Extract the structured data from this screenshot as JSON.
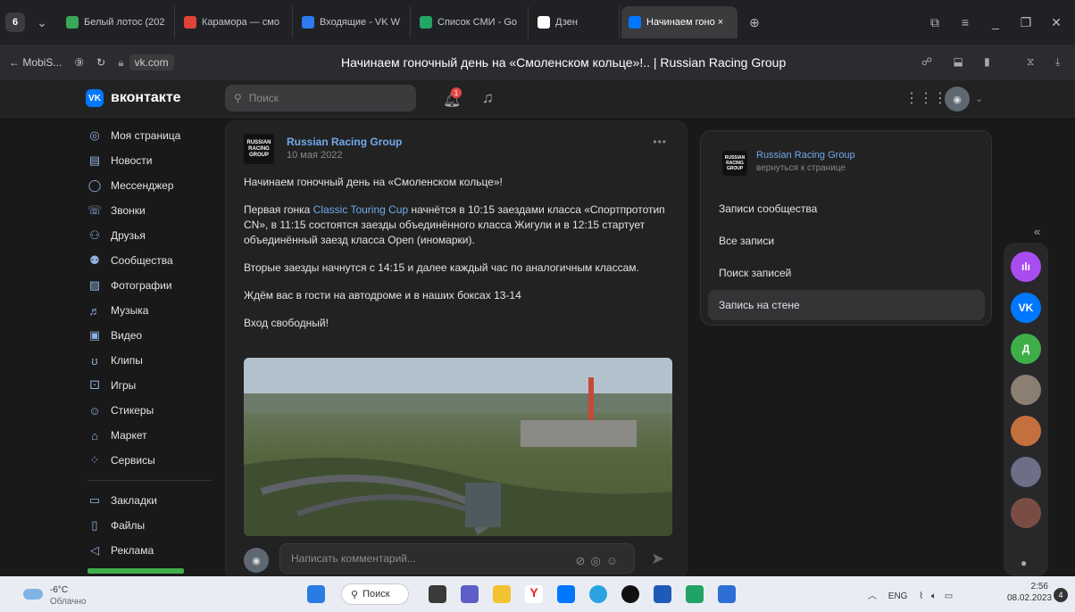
{
  "browser": {
    "tab_count": "6",
    "tabs": [
      {
        "label": "Белый лотос (202",
        "color": "#3aa657"
      },
      {
        "label": "Карамора — смо",
        "color": "#e0433a"
      },
      {
        "label": "Входящие - VK W",
        "color": "#2e7bf0"
      },
      {
        "label": "Список СМИ - Go",
        "color": "#23a566"
      },
      {
        "label": "Дзен",
        "color": "#ffffff"
      },
      {
        "label": "Начинаем гоно ×",
        "color": "#0077ff"
      }
    ],
    "back_label": "← MobiS...",
    "url": "vk.com",
    "page_title": "Начинаем гоночный день на «Смоленском кольце»!.. | Russian Racing Group"
  },
  "vk": {
    "logo_text": "вконтакте",
    "logo_mark": "VK",
    "search_placeholder": "Поиск",
    "notif_count": "1",
    "nav": [
      {
        "label": "Моя страница",
        "icon": "user-icon"
      },
      {
        "label": "Новости",
        "icon": "news-icon"
      },
      {
        "label": "Мессенджер",
        "icon": "message-icon"
      },
      {
        "label": "Звонки",
        "icon": "phone-icon"
      },
      {
        "label": "Друзья",
        "icon": "friends-icon"
      },
      {
        "label": "Сообщества",
        "icon": "communities-icon"
      },
      {
        "label": "Фотографии",
        "icon": "photo-icon"
      },
      {
        "label": "Музыка",
        "icon": "music-icon"
      },
      {
        "label": "Видео",
        "icon": "video-icon"
      },
      {
        "label": "Клипы",
        "icon": "clips-icon"
      },
      {
        "label": "Игры",
        "icon": "games-icon"
      },
      {
        "label": "Стикеры",
        "icon": "stickers-icon"
      },
      {
        "label": "Маркет",
        "icon": "market-icon"
      },
      {
        "label": "Сервисы",
        "icon": "services-icon"
      }
    ],
    "nav_bottom": [
      {
        "label": "Закладки",
        "icon": "bookmark-icon"
      },
      {
        "label": "Файлы",
        "icon": "files-icon"
      },
      {
        "label": "Реклама",
        "icon": "ads-icon"
      }
    ]
  },
  "post": {
    "author": "Russian Racing Group",
    "avatar_text": "RUSSIAN RACING GROUP",
    "date": "10 мая 2022",
    "more": "•••",
    "p1": "Начинаем гоночный день на «Смоленском кольце»!",
    "p2_link": "Classic Touring Cup",
    "p2_pre": "Первая гонка ",
    "p2_post": " начнётся в 10:15 заездами класса «Спортпрототип CN», в 11:15 состоятся заезды объединённого класса Жигули и в 12:15 стартует объединённый заезд класса Open (иномарки).",
    "p3": "Вторые заезды начнутся с 14:15 и далее каждый час по аналогичным классам.",
    "p4": "Ждём вас в гости на автодроме и в наших боксах 13-14",
    "p5": "Вход свободный!",
    "comment_placeholder": "Написать комментарий..."
  },
  "sidebar": {
    "group": "Russian Racing Group",
    "back": "вернуться к странице",
    "links": [
      {
        "label": "Записи сообщества"
      },
      {
        "label": "Все записи"
      },
      {
        "label": "Поиск записей"
      },
      {
        "label": "Запись на стене"
      }
    ]
  },
  "dock": {
    "items": [
      {
        "name": "vk-music-icon",
        "color": "#a94cf0",
        "text": "ılı"
      },
      {
        "name": "vk-app-icon",
        "color": "#0077ff",
        "text": "VK"
      },
      {
        "name": "contact-d-avatar",
        "color": "#3fae49",
        "text": "Д"
      },
      {
        "name": "contact-avatar-1",
        "color": "#8a7f70",
        "text": ""
      },
      {
        "name": "contact-avatar-2",
        "color": "#c4703e",
        "text": ""
      },
      {
        "name": "contact-avatar-3",
        "color": "#6c6f86",
        "text": ""
      },
      {
        "name": "contact-avatar-4",
        "color": "#7a4d44",
        "text": ""
      }
    ]
  },
  "taskbar": {
    "temp": "-6°C",
    "condition": "Облачно",
    "search_label": "Поиск",
    "lang": "ENG",
    "time": "2:56",
    "date": "08.02.2023",
    "notif_count": "4"
  }
}
